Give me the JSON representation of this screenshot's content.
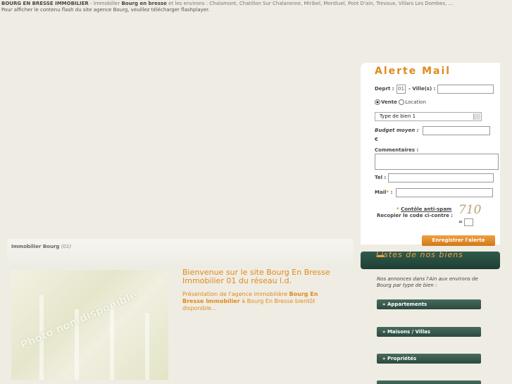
{
  "top": {
    "brand": "BOURG EN BRESSE IMMOBILIER",
    "sep": " - Immobilier ",
    "keyword": "Bourg en bresse",
    "rest": " et les environs : Chalamont, Chatillon Sur Chalaronne, Miribel, Montluel, Pont D'ain, Trevoux, Villars Les Dombes, ...",
    "flash_msg": "Pour afficher le contenu flash du site agence Bourg, veuillez télécharger flashplayer."
  },
  "alert": {
    "title": "Alerte Mail",
    "deprt_label": "Deprt :",
    "deprt_value": "01",
    "villes_label": "- Ville(s) :",
    "vente_label": "Vente",
    "location_label": "Location",
    "type_selected": "Type de bien 1",
    "budget_label": "Budget moyen :",
    "euro": "€",
    "comments_label": "Commentaires :",
    "tel_label": "Tel :",
    "mail_label": "Mail",
    "mail_star": "*",
    "mail_colon": " :",
    "antispam_star": "*",
    "antispam_label": "Contôle anti-spam",
    "recopier_label": "Recopier le code ci-contre :",
    "equals": "=",
    "captcha": "710",
    "submit_label": "Enregistrer l'alerte"
  },
  "listes": {
    "title": "Listes de nos biens",
    "desc": "Nos annonces dans l'Ain aux environs de Bourg par type de bien :",
    "items": [
      "» Appartements",
      "» Maisons / Villas",
      "» Propriétés"
    ]
  },
  "main": {
    "header_title": "Immobilier Bourg",
    "header_dept": "(01)",
    "photo_label": "Photo non disponible",
    "welcome": "Bienvenue sur le site Bourg En Bresse Immobilier 01 du réseau l.d.",
    "pres_a": "Présentation de l'agence immobilière ",
    "pres_b": "Bourg En Bresse Immobilier",
    "pres_c": " à Bourg En Bresse bientôt disponible..."
  }
}
